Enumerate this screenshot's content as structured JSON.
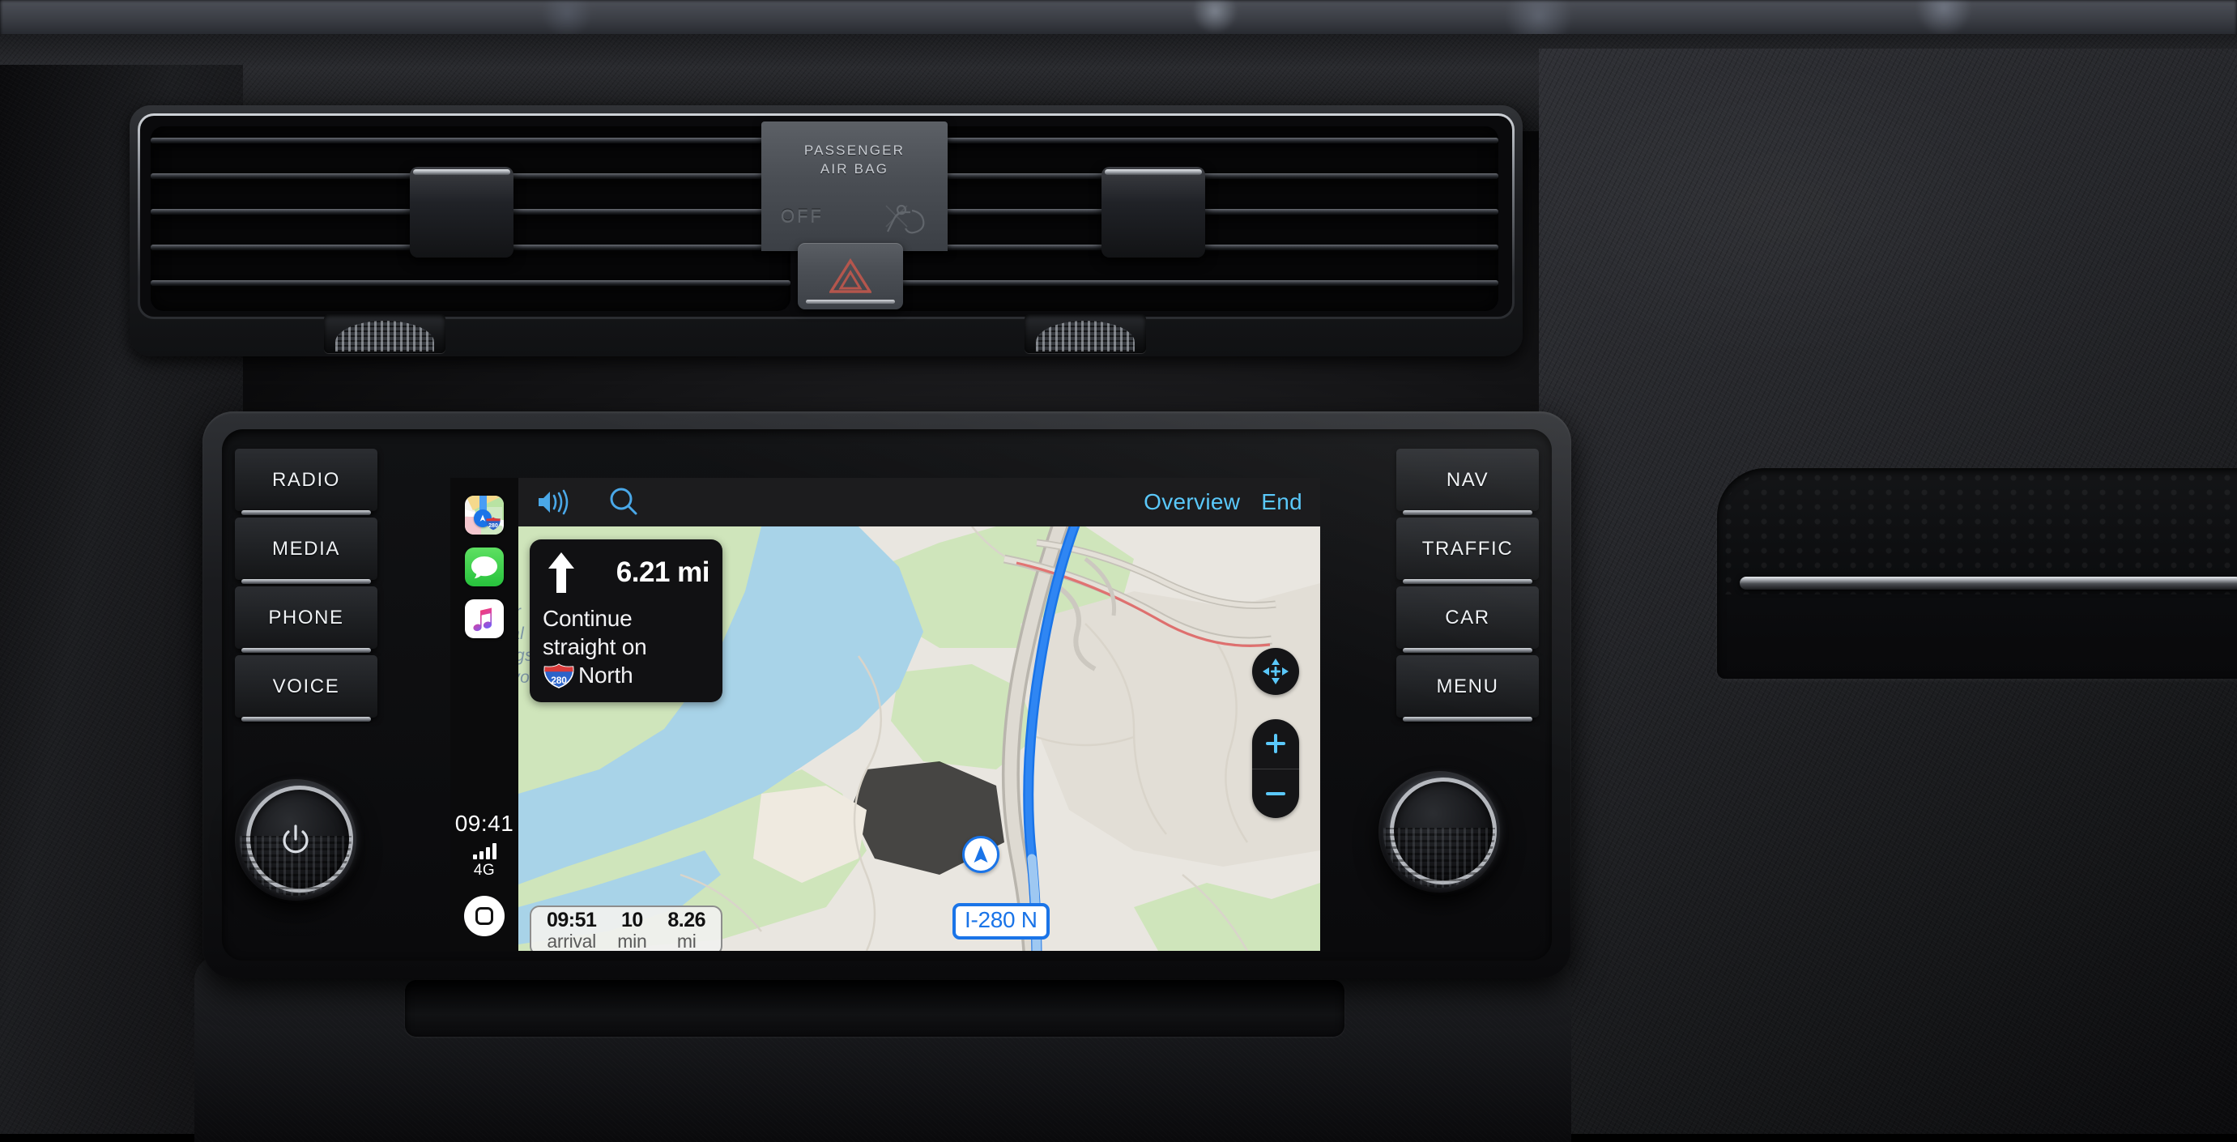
{
  "vehicle": {
    "airbag_plaque": {
      "line1": "PASSENGER",
      "line2": "AIR BAG",
      "status": "OFF",
      "icon": "airbag-off-icon"
    },
    "hazard_button": {
      "icon": "hazard-triangle-icon"
    },
    "left_buttons": [
      {
        "label": "RADIO",
        "name": "radio-button"
      },
      {
        "label": "MEDIA",
        "name": "media-button"
      },
      {
        "label": "PHONE",
        "name": "phone-button"
      },
      {
        "label": "VOICE",
        "name": "voice-button"
      }
    ],
    "right_buttons": [
      {
        "label": "NAV",
        "name": "nav-button"
      },
      {
        "label": "TRAFFIC",
        "name": "traffic-button"
      },
      {
        "label": "CAR",
        "name": "car-button"
      },
      {
        "label": "MENU",
        "name": "menu-button"
      }
    ],
    "knobs": [
      {
        "name": "power-volume-knob",
        "icon": "power-icon"
      },
      {
        "name": "tune-scroll-knob",
        "icon": ""
      }
    ]
  },
  "carplay": {
    "sidebar": {
      "apps": [
        {
          "name": "app-icon-maps",
          "label": "Maps",
          "icon": "maps-icon"
        },
        {
          "name": "app-icon-messages",
          "label": "Messages",
          "icon": "messages-icon"
        },
        {
          "name": "app-icon-music",
          "label": "Music",
          "icon": "music-icon"
        }
      ],
      "clock": "09:41",
      "signal_bars": 4,
      "network": "4G",
      "home_button": {
        "icon": "home-icon"
      }
    },
    "topbar": {
      "volume_icon": "speaker-waves-icon",
      "search_icon": "search-icon",
      "overview_label": "Overview",
      "end_label": "End",
      "accent_color": "#5ac8fa"
    },
    "navigation": {
      "maneuver_icon": "straight-arrow-icon",
      "distance": "6.21 mi",
      "instruction_line1": "Continue",
      "instruction_line2": "straight on",
      "route_shield": "280",
      "route_shield_type": "interstate",
      "instruction_line3": "North",
      "eta": [
        {
          "value": "09:51",
          "label": "arrival"
        },
        {
          "value": "10",
          "label": "min"
        },
        {
          "value": "8.26",
          "label": "mi"
        }
      ],
      "road_badge": "I-280 N",
      "map_label": "Lower Crystal Springs Reservoir",
      "map_label_visible_lines": [
        "er",
        "tal",
        "ngs",
        "rvoir"
      ],
      "route_color": "#1a74e8",
      "position_puck": "navigation-arrow-icon"
    },
    "map_controls": {
      "pan_icon": "pan-arrows-icon",
      "zoom_in_icon": "plus-icon",
      "zoom_out_icon": "minus-icon"
    }
  }
}
